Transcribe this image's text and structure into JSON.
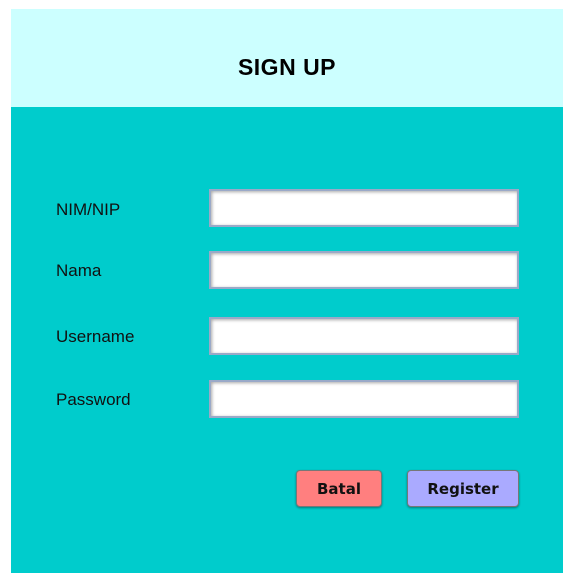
{
  "header": {
    "title": "SIGN UP"
  },
  "form": {
    "fields": [
      {
        "label": "NIM/NIP",
        "value": "",
        "placeholder": ""
      },
      {
        "label": "Nama",
        "value": "",
        "placeholder": ""
      },
      {
        "label": "Username",
        "value": "",
        "placeholder": ""
      },
      {
        "label": "Password",
        "value": "",
        "placeholder": ""
      }
    ]
  },
  "actions": {
    "cancel_label": "Batal",
    "register_label": "Register"
  },
  "colors": {
    "header_bg": "#ccffff",
    "panel_bg": "#00cccc",
    "cancel_bg": "#ff7f7f",
    "register_bg": "#aaaaff"
  }
}
